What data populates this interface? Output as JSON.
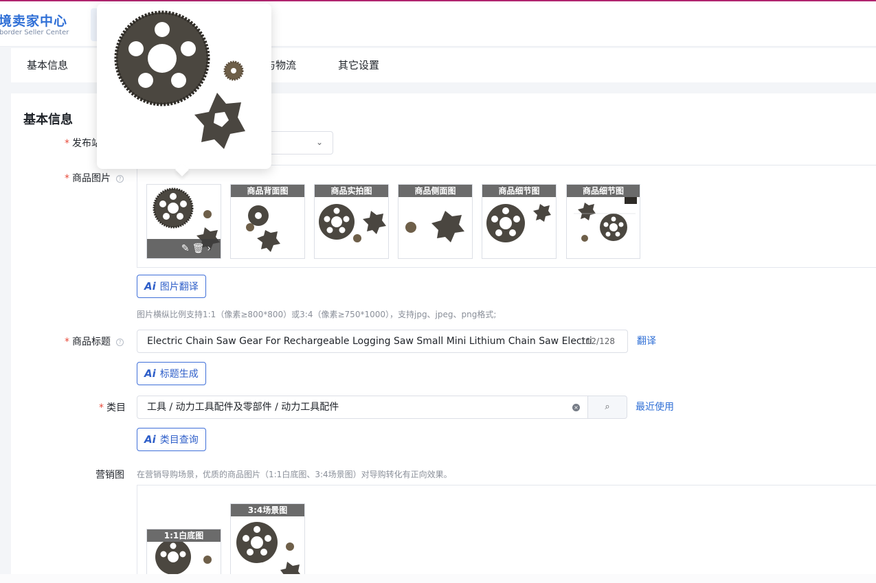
{
  "header": {
    "logo_title": "跨境卖家中心",
    "logo_subtitle": "Cross-border Seller Center"
  },
  "tabs": [
    {
      "label": "基本信息"
    },
    {
      "label": "包装与物流"
    },
    {
      "label": "其它设置"
    }
  ],
  "section": {
    "title": "基本信息"
  },
  "form": {
    "publish_label": "发布站点",
    "images_label": "商品图片",
    "image_captions": [
      "商品背面图",
      "商品实拍图",
      "商品侧面图",
      "商品细节图",
      "商品细节图"
    ],
    "image_translate_btn": "图片翻译",
    "image_hint": "图片横纵比例支持1:1（像素≥800*800）或3:4（像素≥750*1000），支持jpg、jpeg、png格式;",
    "title_label": "商品标题",
    "title_value": "Electric Chain Saw Gear For Rechargeable Logging Saw Small Mini Lithium Chain Saw Electri",
    "title_counter": "112/128",
    "title_translate_link": "翻译",
    "title_gen_btn": "标题生成",
    "category_label": "类目",
    "category_value": "工具 / 动力工具配件及零部件 / 动力工具配件",
    "category_recent_link": "最近使用",
    "category_query_btn": "类目查询",
    "marketing_label": "营销图",
    "marketing_hint": "在营销导购场景，优质的商品图片（1:1白底图、3:4场景图）对导购转化有正向效果。",
    "marketing_captions": [
      "1:1白底图",
      "3:4场景图"
    ]
  },
  "icons": {
    "ai": "Ai",
    "help": "?",
    "chevron": "⌄",
    "clear": "×",
    "search": "⌕",
    "tools": "✎🗑›"
  }
}
